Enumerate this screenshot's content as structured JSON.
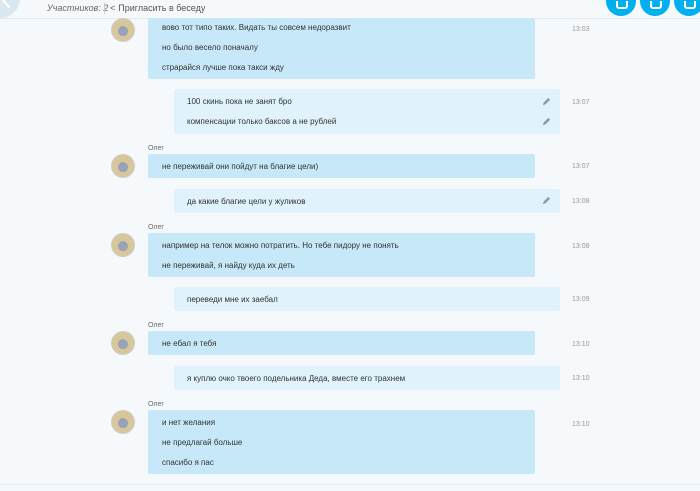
{
  "header": {
    "participants_label": "Участников: 2",
    "invite_label": "Пригласить в беседу"
  },
  "colors": {
    "accent": "#00aff0",
    "incoming_bubble": "#c6e8f8",
    "outgoing_bubble": "#e0f2fb"
  },
  "messages": [
    {
      "sender": "",
      "direction": "incoming",
      "lines": [
        "вово тот типо таких. Видать ты совсем недоразвит",
        "но было весело поначалу",
        "страрайся лучше пока такси жду"
      ],
      "time": "13:03"
    },
    {
      "direction": "outgoing",
      "lines": [
        "100 скинь пока не занят  бро",
        "компенсации  только баксов а не рублей"
      ],
      "time": "13:07"
    },
    {
      "sender": "Олег",
      "direction": "incoming",
      "lines": [
        "не переживай они пойдут на благие цели)"
      ],
      "time": "13:07"
    },
    {
      "direction": "outgoing",
      "lines": [
        "да какие благие цели у жуликов"
      ],
      "time": "13:08"
    },
    {
      "sender": "Олег",
      "direction": "incoming",
      "lines": [
        "например на телок можно потратить. Но тебе пидору не понять",
        "не переживай, я найду куда их деть"
      ],
      "time": "13:08"
    },
    {
      "direction": "outgoing",
      "lines": [
        "переведи мне  их заебал"
      ],
      "time": "13:09"
    },
    {
      "sender": "Олег",
      "direction": "incoming",
      "lines": [
        "не ебал я тебя"
      ],
      "time": "13:10"
    },
    {
      "direction": "outgoing",
      "lines": [
        "я куплю очко твоего подельника Деда, вместе его трахнем"
      ],
      "time": "13:10"
    },
    {
      "sender": "Олег",
      "direction": "incoming",
      "lines": [
        "и нет желания",
        "не предлагай больше",
        "спасибо я пас"
      ],
      "time": "13:10"
    }
  ]
}
